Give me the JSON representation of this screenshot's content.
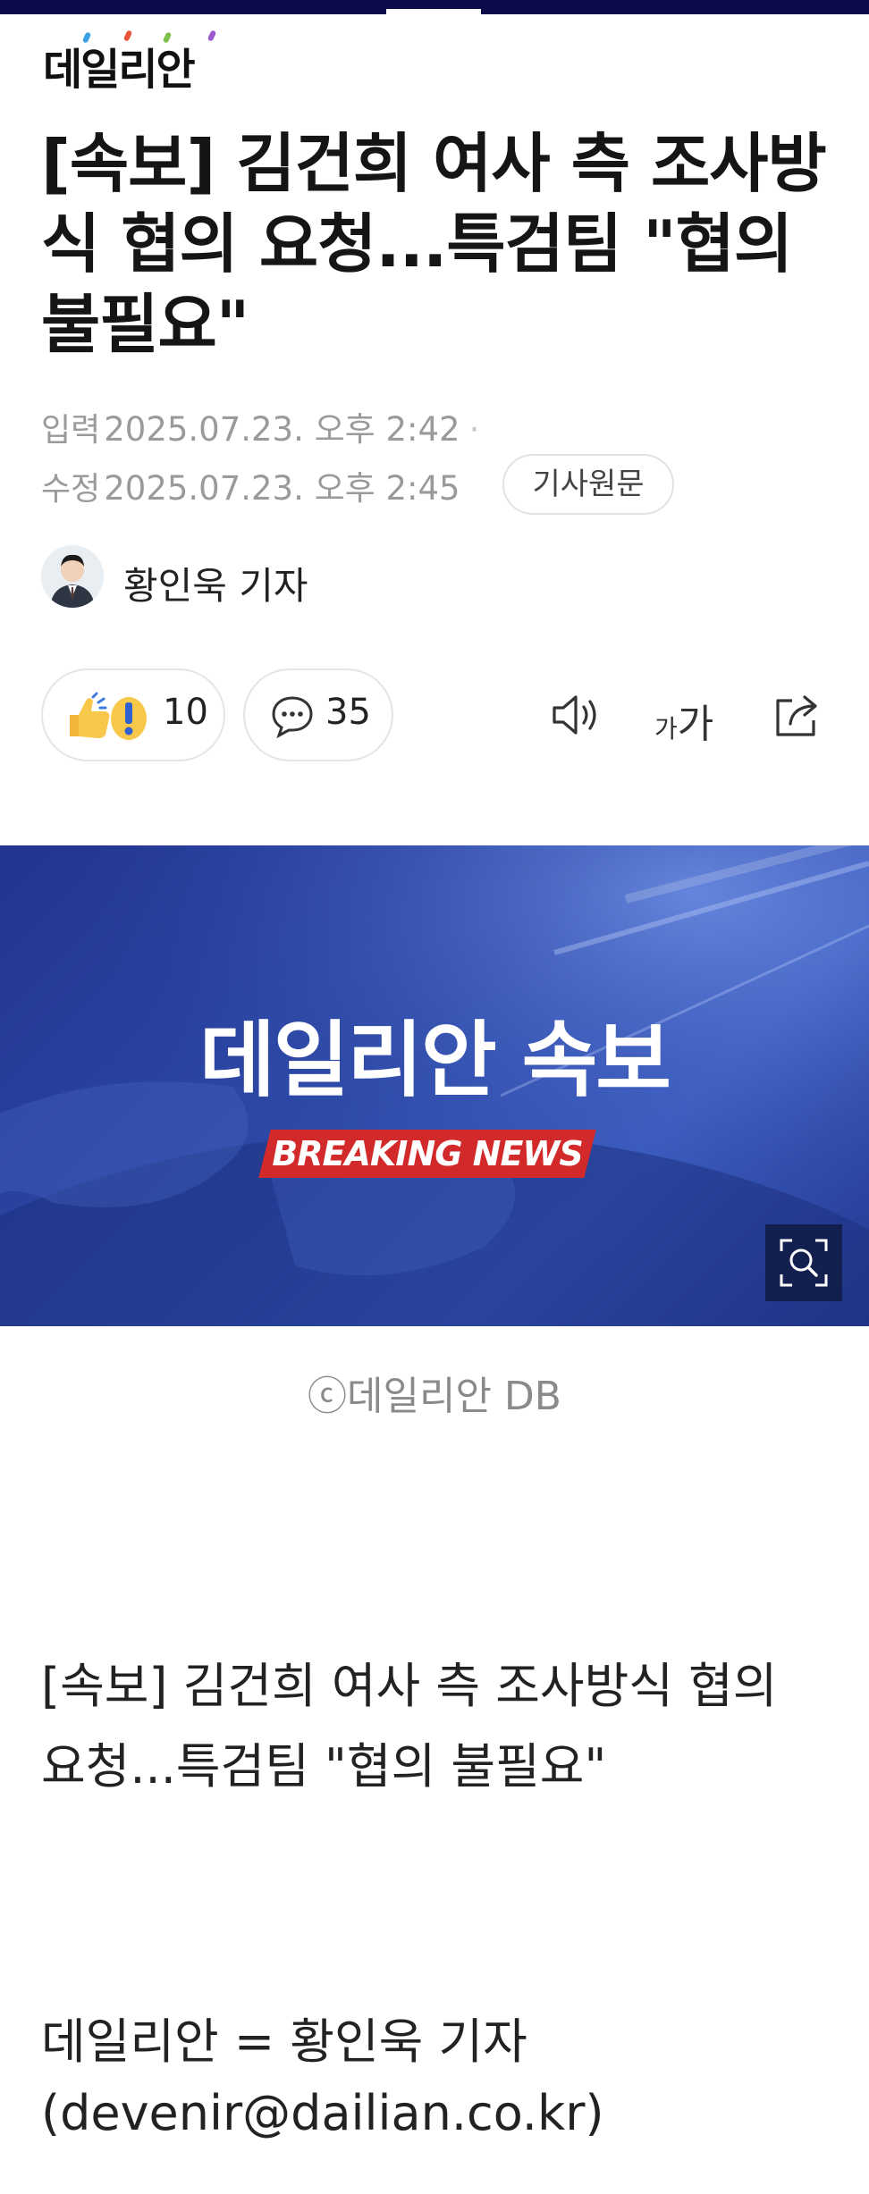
{
  "site": {
    "logo_text": "데일리안",
    "logo_dot_colors": [
      "#3aa0e6",
      "#e8553b",
      "#7cc24a",
      "#9b59d0"
    ]
  },
  "article": {
    "headline": "[속보] 김건희 여사 측 조사방식 협의 요청...특검팀 \"협의 불필요\"",
    "published_label": "입력",
    "published": "2025.07.23. 오후 2:42",
    "updated_label": "수정",
    "updated": "2025.07.23. 오후 2:45",
    "original_button": "기사원문",
    "reporter": "황인욱 기자",
    "reaction_count": "10",
    "comment_count": "35",
    "toolbar": {
      "speaker_icon": "speaker-icon",
      "font_size_label": "가가",
      "share_icon": "share-icon"
    },
    "image": {
      "title": "데일리안 속보",
      "badge": "BREAKING NEWS",
      "caption": "ⓒ데일리안 DB",
      "zoom_icon": "zoom-search-icon"
    },
    "body_headline": "[속보] 김건희 여사 측 조사방식 협의 요청...특검팀 \"협의 불필요\"",
    "byline": "데일리안 = 황인욱 기자",
    "email": "(devenir@dailian.co.kr)"
  },
  "colors": {
    "top_bar": "#0d0a4a",
    "meta_text": "#9a9a9a",
    "badge_red": "#d22a2a",
    "hero_blue": "#2d4aa8"
  }
}
